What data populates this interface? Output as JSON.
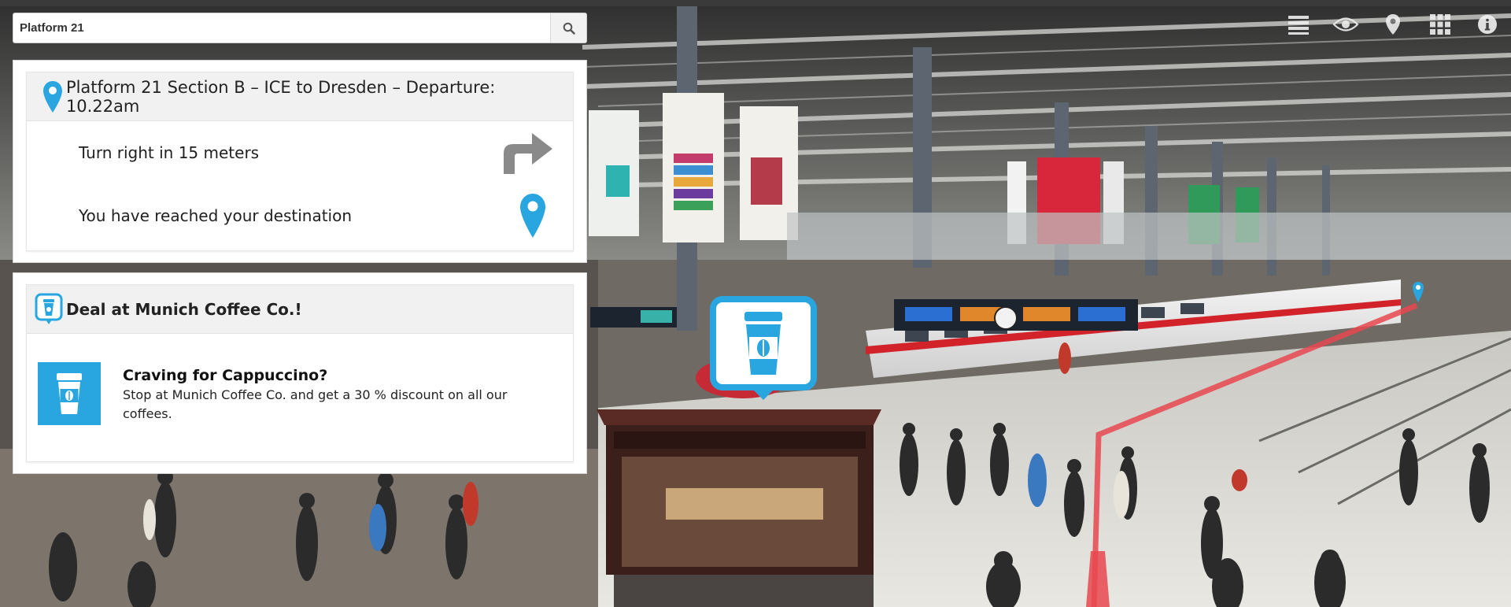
{
  "search": {
    "value": "Platform 21",
    "placeholder": ""
  },
  "top_icons": [
    "list-icon",
    "eye-icon",
    "map-pin-icon",
    "grid-icon",
    "info-icon"
  ],
  "navigation": {
    "header": "Platform 21 Section B – ICE to Dresden – Departure: 10.22am",
    "steps": [
      {
        "text": "Turn right in 15 meters",
        "icon": "turn-right-arrow-icon"
      },
      {
        "text": "You have reached your destination",
        "icon": "destination-pin-icon"
      }
    ]
  },
  "deal": {
    "header": "Deal at Munich Coffee Co.!",
    "headline": "Craving for Cappuccino?",
    "description": "Stop at Munich Coffee Co. and get a 30 % discount on all our coffees."
  },
  "colors": {
    "accent": "#29a6e0",
    "route": "#e8484f",
    "arrow": "#8a8a8a"
  }
}
